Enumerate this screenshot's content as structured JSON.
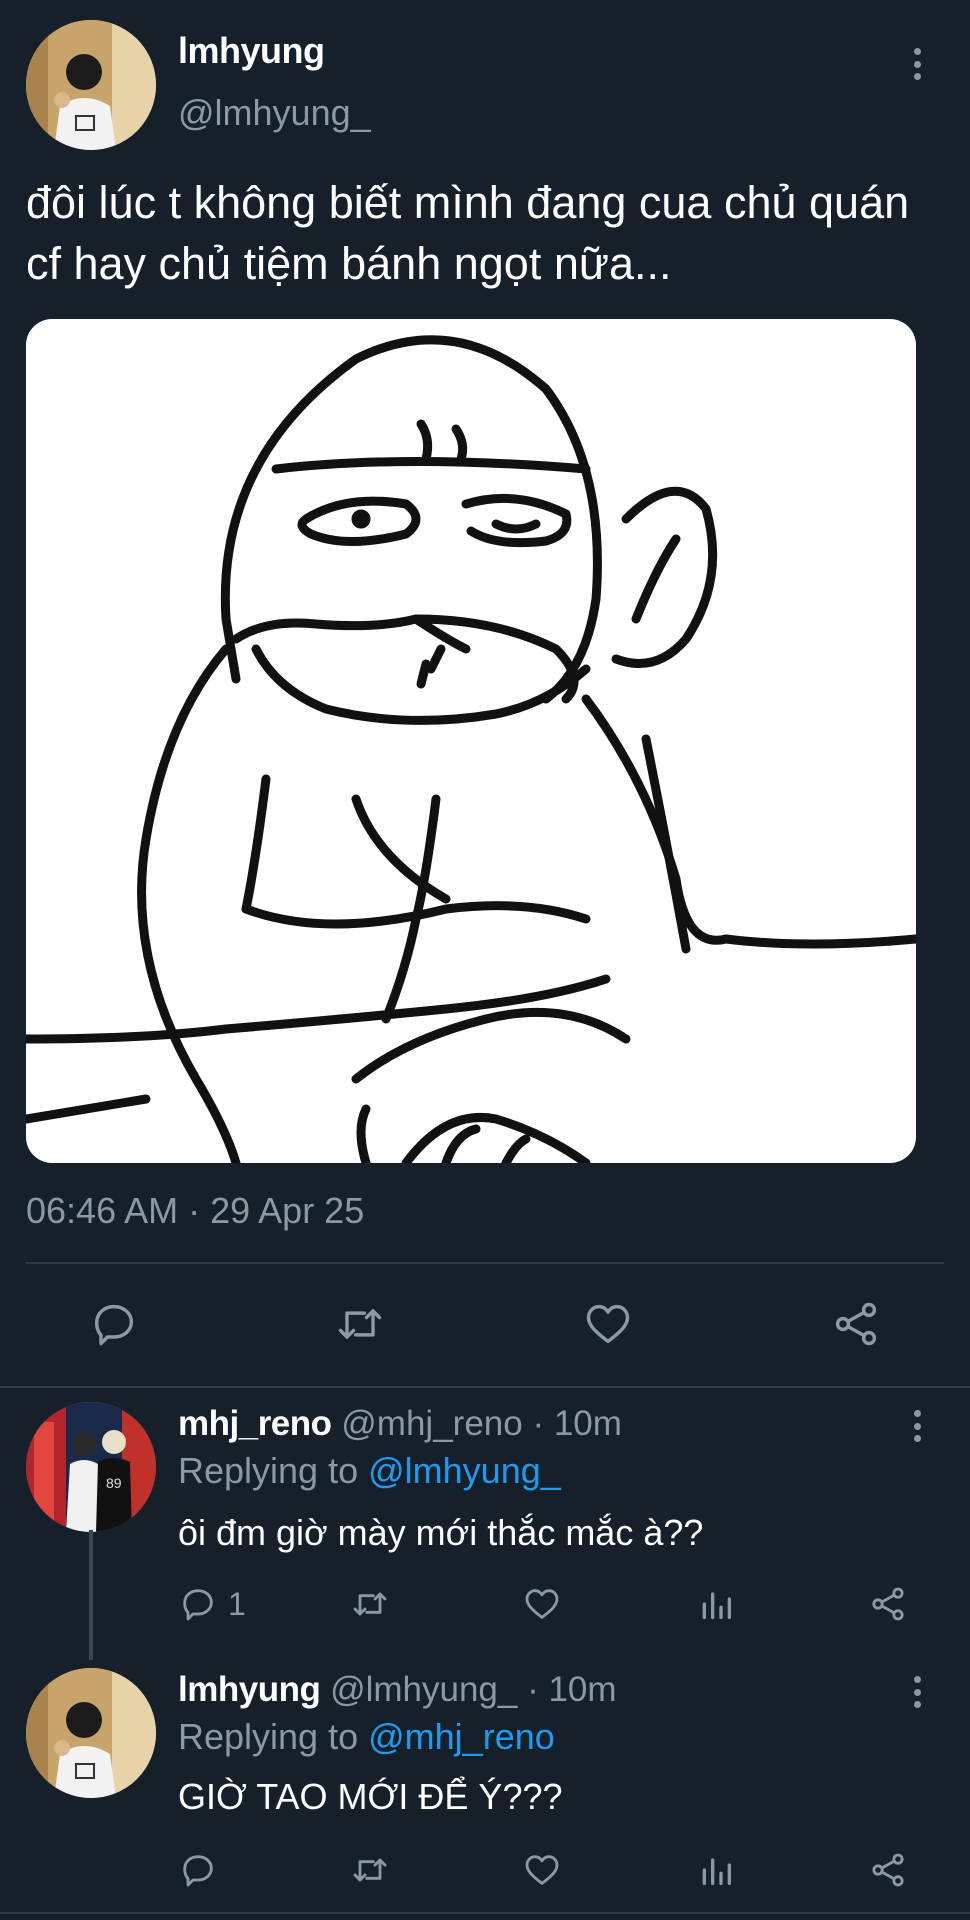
{
  "main_tweet": {
    "display_name": "lmhyung",
    "handle": "@lmhyung_",
    "text": "đôi lúc t không biết mình đang cua chủ quán cf hay chủ tiệm bánh ngọt nữa...",
    "timestamp": "06:46 AM · 29 Apr 25",
    "actions": [
      "reply-icon",
      "retweet-icon",
      "like-icon",
      "share-icon"
    ]
  },
  "replies": [
    {
      "display_name": "mhj_reno",
      "meta": "@mhj_reno · 10m",
      "replying_label": "Replying to",
      "replying_to": "@lmhyung_",
      "text": "ôi đm giờ mày mới thắc mắc à??",
      "reply_count": "1"
    },
    {
      "display_name": "lmhyung",
      "meta": "@lmhyung_ · 10m",
      "replying_label": "Replying to",
      "replying_to": "@mhj_reno",
      "text": "GIỜ TAO MỚI ĐỂ Ý???",
      "reply_count": ""
    }
  ],
  "colors": {
    "background": "#15202b",
    "secondary_text": "#8b98a5",
    "mention": "#1d9bf0",
    "divider": "#2f3b47"
  }
}
